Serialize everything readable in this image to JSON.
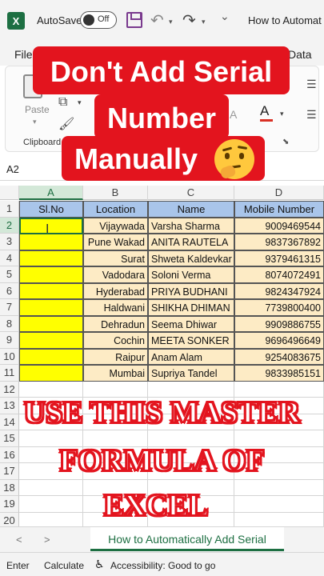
{
  "titlebar": {
    "logo": "X",
    "autosave_label": "AutoSave",
    "autosave_state": "Off",
    "doc_title": "How to Automat"
  },
  "ribbon": {
    "tab_file": "File",
    "tab_data": "Data",
    "paste_label": "Paste",
    "clipboard_label": "Clipboard",
    "font_color_glyph": "A",
    "font_color": "#d93025"
  },
  "formula_bar": {
    "name_box": "A2"
  },
  "grid": {
    "columns": [
      "A",
      "B",
      "C",
      "D"
    ],
    "rows": [
      "1",
      "2",
      "3",
      "4",
      "5",
      "6",
      "7",
      "8",
      "9",
      "10",
      "11",
      "12",
      "13",
      "14",
      "15",
      "16",
      "17",
      "18",
      "19",
      "20"
    ],
    "headers": [
      "Sl.No",
      "Location",
      "Name",
      "Mobile Number"
    ],
    "data": [
      {
        "location": "Vijaywada",
        "name": "Varsha Sharma",
        "mobile": "9009469544"
      },
      {
        "location": "Pune Wakad",
        "name": "ANITA RAUTELA",
        "mobile": "9837367892"
      },
      {
        "location": "Surat",
        "name": "Shweta Kaldevkar",
        "mobile": "9379461315"
      },
      {
        "location": "Vadodara",
        "name": "Soloni Verma",
        "mobile": "8074072491"
      },
      {
        "location": "Hyderabad",
        "name": "PRIYA BUDHANI",
        "mobile": "9824347924"
      },
      {
        "location": "Haldwani",
        "name": "SHIKHA DHIMAN",
        "mobile": "7739800400"
      },
      {
        "location": "Dehradun",
        "name": "Seema Dhiwar",
        "mobile": "9909886755"
      },
      {
        "location": "Cochin",
        "name": "MEETA SONKER",
        "mobile": "9696496649"
      },
      {
        "location": "Raipur",
        "name": "Anam Alam",
        "mobile": "9254083675"
      },
      {
        "location": "Mumbai",
        "name": "Supriya Tandel",
        "mobile": "9833985151"
      }
    ]
  },
  "overlay": {
    "line1": "Don't Add Serial",
    "line2": "Number",
    "line3": "Manually",
    "master1": "USE THIS MASTER",
    "master2": "FORMULA OF",
    "master3": "EXCEL",
    "emoji": "thinking-face"
  },
  "sheetbar": {
    "prev": "<",
    "next": ">",
    "sheet_tab": "How to Automatically Add Serial"
  },
  "statusbar": {
    "mode": "Enter",
    "calc": "Calculate",
    "accessibility": "Accessibility: Good to go"
  },
  "colors": {
    "excel_green": "#1d6f42",
    "header_blue": "#a9c5ea",
    "serial_yellow": "#ffff00",
    "data_peach": "#fdebc5",
    "banner_red": "#e3141e"
  }
}
